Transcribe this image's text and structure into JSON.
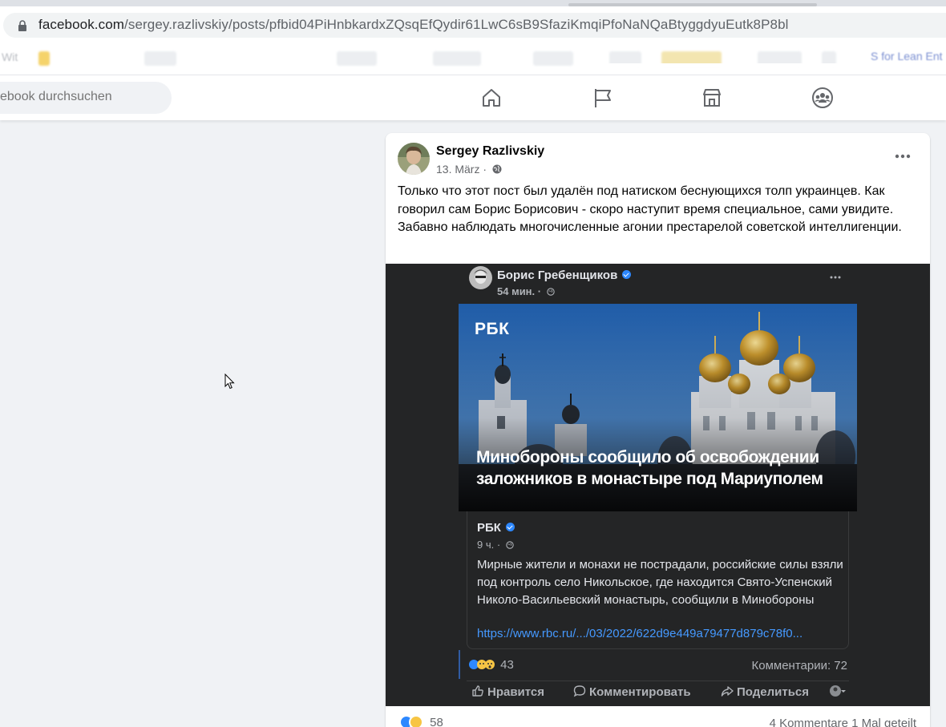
{
  "browser": {
    "url_host": "facebook.com",
    "url_path": "/sergey.razlivskiy/posts/pfbid04PiHnbkardxZQsqEfQydir61LwC6sB9SfaziKmqiPfoNaNQaBtyggdyuEutk8P8bl",
    "bookmark_left": "Wit",
    "bookmark_right": "S for Lean Ent"
  },
  "header": {
    "search_placeholder": "ebook durchsuchen",
    "nav": [
      "home-icon",
      "pages-flag-icon",
      "marketplace-icon",
      "groups-icon"
    ]
  },
  "post": {
    "author": "Sergey Razlivskiy",
    "date": "13. März ·",
    "text": "Только что этот пост был удалён под натиском беснующихся толп украинцев. Как говорил сам Борис Борисович - скоро наступит время специальное, сами увидите. Забавно наблюдать многочисленные агонии престарелой советской интеллигенции.",
    "reactions_count": "58",
    "counts": "4 Kommentare  1 Mal geteilt"
  },
  "embedded": {
    "author": "Борис Гребенщиков",
    "meta": "54 мин. ·",
    "image_logo": "РБК",
    "headline": "Минобороны сообщило об освобождении заложников в монастыре под Мариуполем",
    "quoted_author": "РБК",
    "quoted_meta": "9 ч. ·",
    "quoted_text": "Мирные жители и монахи не пострадали, российские силы взяли под контроль село Никольское, где находится Свято-Успенский Николо-Васильевский монастырь, сообщили в Минобороны",
    "quoted_link": "https://www.rbc.ru/.../03/2022/622d9e449a79477d879c78f0...",
    "reactions_count": "43",
    "comments": "Комментарии: 72",
    "actions": {
      "like": "Нравится",
      "comment": "Комментировать",
      "share": "Поделиться"
    }
  },
  "colors": {
    "fb_bg": "#f0f2f5",
    "dark_bg": "#242526",
    "link_blue": "#4599ff",
    "verified_blue": "#2d88ff"
  }
}
